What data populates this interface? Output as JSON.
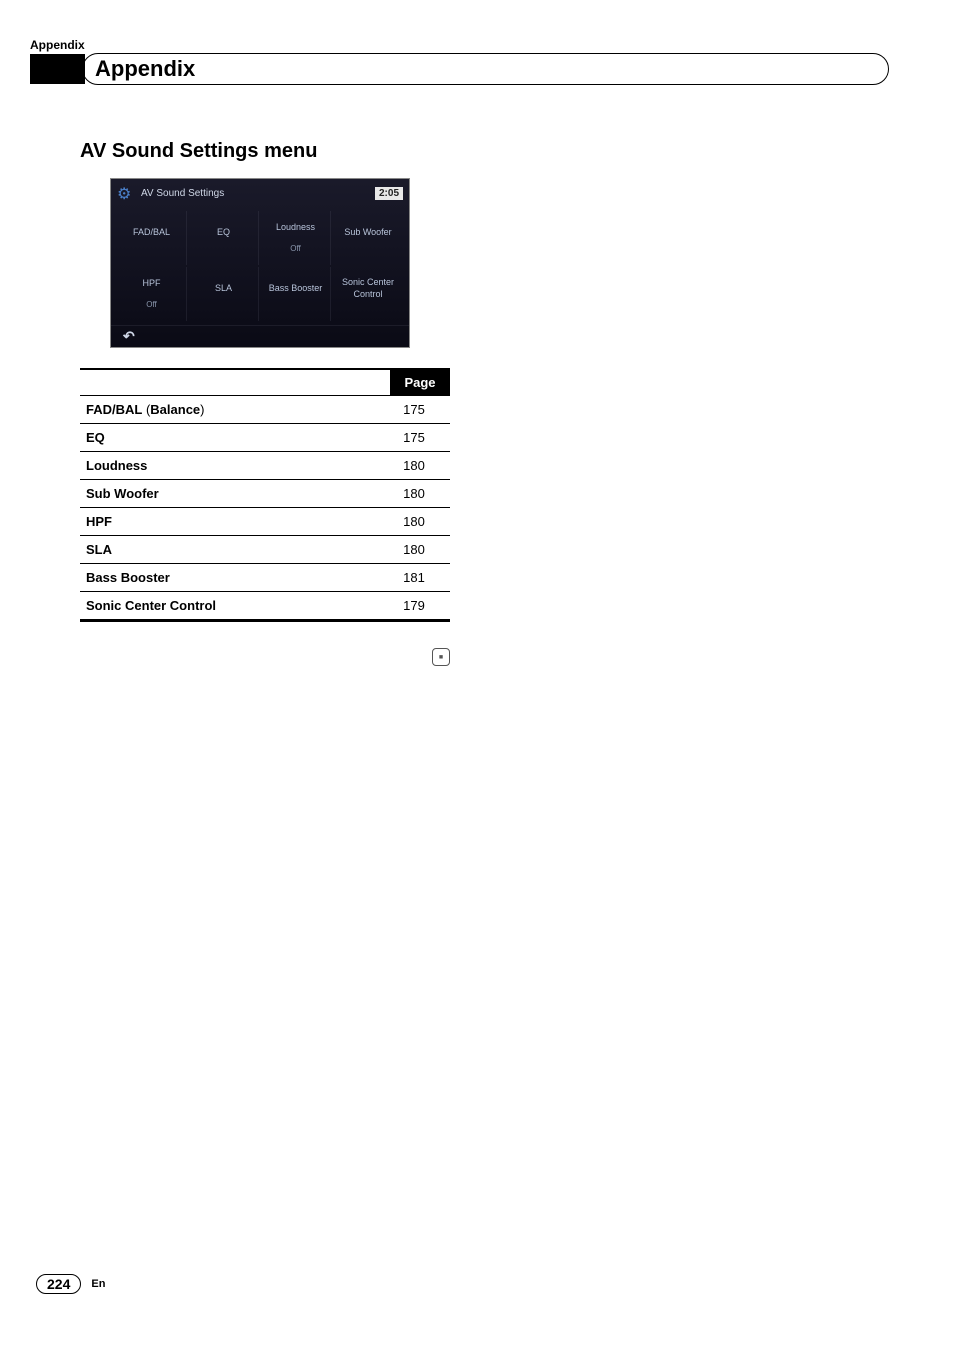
{
  "header": {
    "top_label": "Appendix",
    "title": "Appendix"
  },
  "section": {
    "heading_prefix": "AV Sound Settings ",
    "heading_suffix": "menu"
  },
  "screenshot": {
    "title": "AV Sound Settings",
    "time": "2:05",
    "cells": [
      {
        "label": "FAD/BAL",
        "sub": ""
      },
      {
        "label": "EQ",
        "sub": ""
      },
      {
        "label": "Loudness",
        "sub": "Off"
      },
      {
        "label": "Sub Woofer",
        "sub": ""
      },
      {
        "label": "HPF",
        "sub": "Off"
      },
      {
        "label": "SLA",
        "sub": ""
      },
      {
        "label": "Bass Booster",
        "sub": ""
      },
      {
        "label": "Sonic Center Control",
        "sub": ""
      }
    ]
  },
  "table": {
    "page_header": "Page",
    "rows": [
      {
        "item_bold": "FAD/BAL",
        "item_paren_open": " (",
        "item_balance": "Balance",
        "item_paren_close": ")",
        "page": "175"
      },
      {
        "item_bold": "EQ",
        "item_paren_open": "",
        "item_balance": "",
        "item_paren_close": "",
        "page": "175"
      },
      {
        "item_bold": "Loudness",
        "item_paren_open": "",
        "item_balance": "",
        "item_paren_close": "",
        "page": "180"
      },
      {
        "item_bold": "Sub Woofer",
        "item_paren_open": "",
        "item_balance": "",
        "item_paren_close": "",
        "page": "180"
      },
      {
        "item_bold": "HPF",
        "item_paren_open": "",
        "item_balance": "",
        "item_paren_close": "",
        "page": "180"
      },
      {
        "item_bold": "SLA",
        "item_paren_open": "",
        "item_balance": "",
        "item_paren_close": "",
        "page": "180"
      },
      {
        "item_bold": "Bass Booster",
        "item_paren_open": "",
        "item_balance": "",
        "item_paren_close": "",
        "page": "181"
      },
      {
        "item_bold": "Sonic Center Control",
        "item_paren_open": "",
        "item_balance": "",
        "item_paren_close": "",
        "page": "179"
      }
    ]
  },
  "footer": {
    "page_number": "224",
    "language": "En"
  }
}
